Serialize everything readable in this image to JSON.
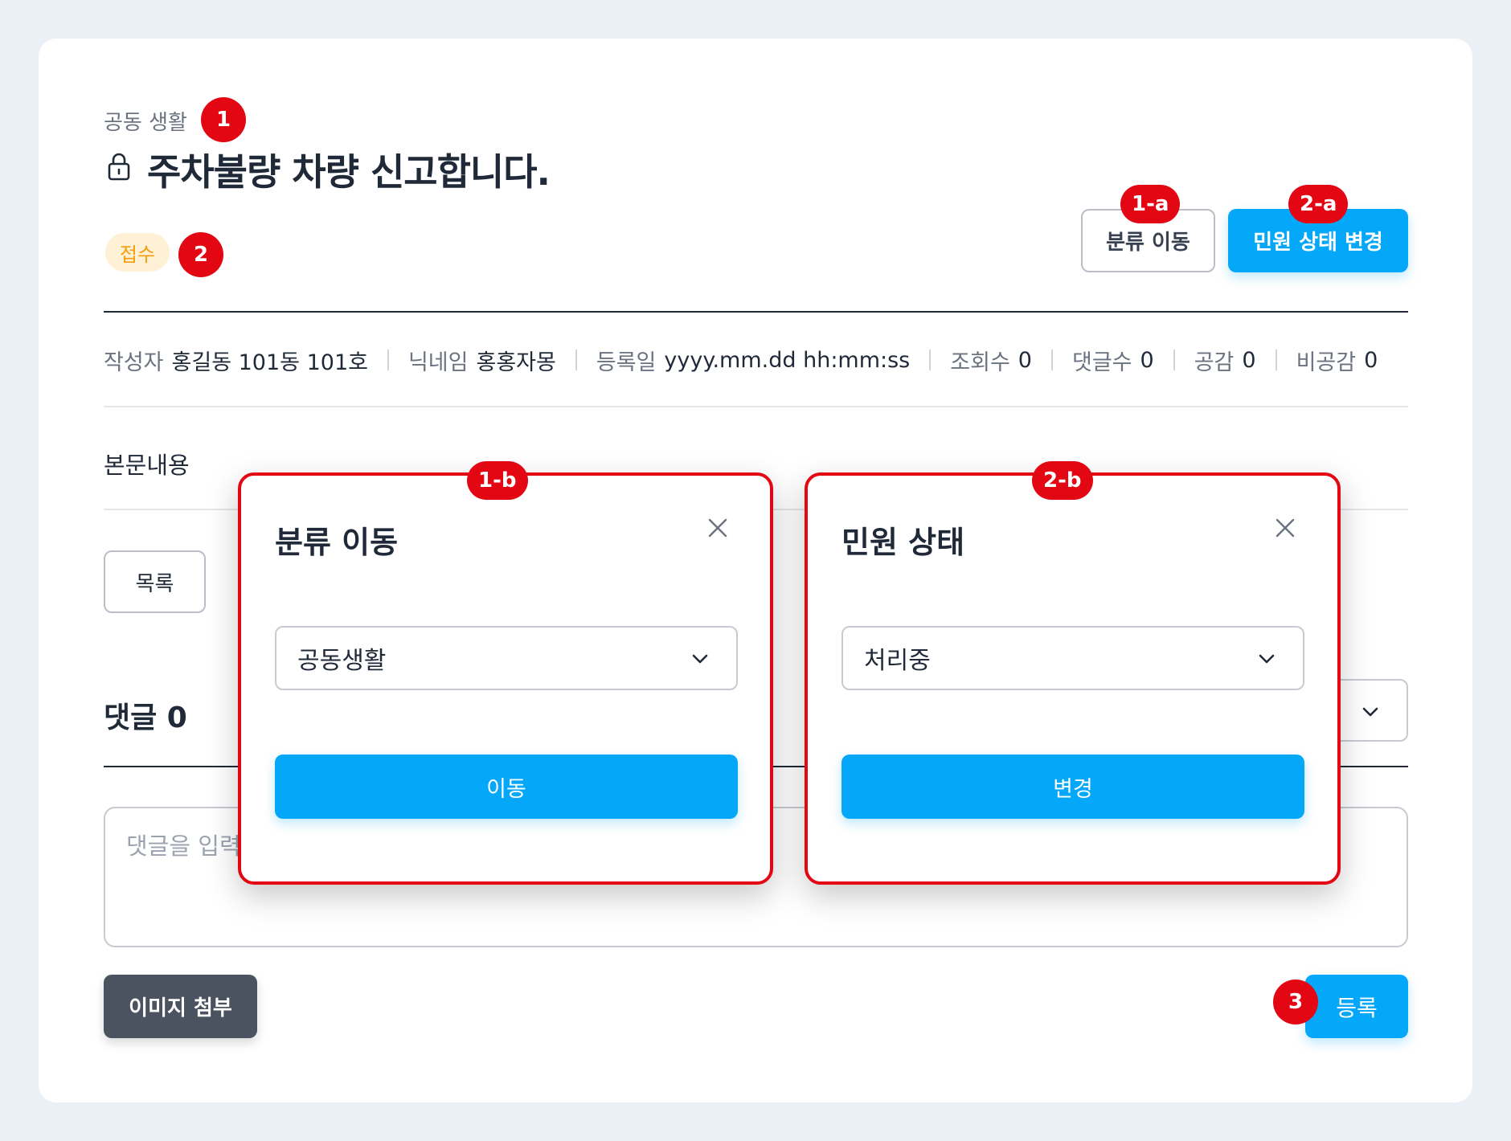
{
  "post": {
    "category": "공동 생활",
    "title": "주차불량 차량 신고합니다.",
    "status_badge": "접수",
    "body_label": "본문내용"
  },
  "actions": {
    "move_category": "분류 이동",
    "change_status": "민원 상태 변경",
    "list": "목록",
    "attach_image": "이미지 첨부",
    "submit": "등록"
  },
  "meta": {
    "author_label": "작성자",
    "author_value": "홍길동 101동 101호",
    "nickname_label": "닉네임",
    "nickname_value": "홍홍자몽",
    "date_label": "등록일",
    "date_value": "yyyy.mm.dd hh:mm:ss",
    "views_label": "조회수",
    "views_value": "0",
    "comments_label": "댓글수",
    "comments_value": "0",
    "likes_label": "공감",
    "likes_value": "0",
    "dislikes_label": "비공감",
    "dislikes_value": "0"
  },
  "comments": {
    "title": "댓글 0",
    "placeholder": "댓글을 입력"
  },
  "modal_category": {
    "title": "분류 이동",
    "selected": "공동생활",
    "action": "이동"
  },
  "modal_status": {
    "title": "민원 상태",
    "selected": "처리중",
    "action": "변경"
  },
  "markers": [
    "1",
    "2",
    "1-a",
    "2-a",
    "1-b",
    "2-b",
    "3"
  ],
  "colors": {
    "primary": "#05a7f9",
    "annotation": "#e30613",
    "badge_bg": "#fff1d6",
    "badge_text": "#f59e0b",
    "dark_button": "#4b5260",
    "page_bg": "#ebf0f7"
  },
  "icons": {
    "lock": "lock-icon",
    "chevron": "chevron-down-icon",
    "close": "close-icon"
  }
}
